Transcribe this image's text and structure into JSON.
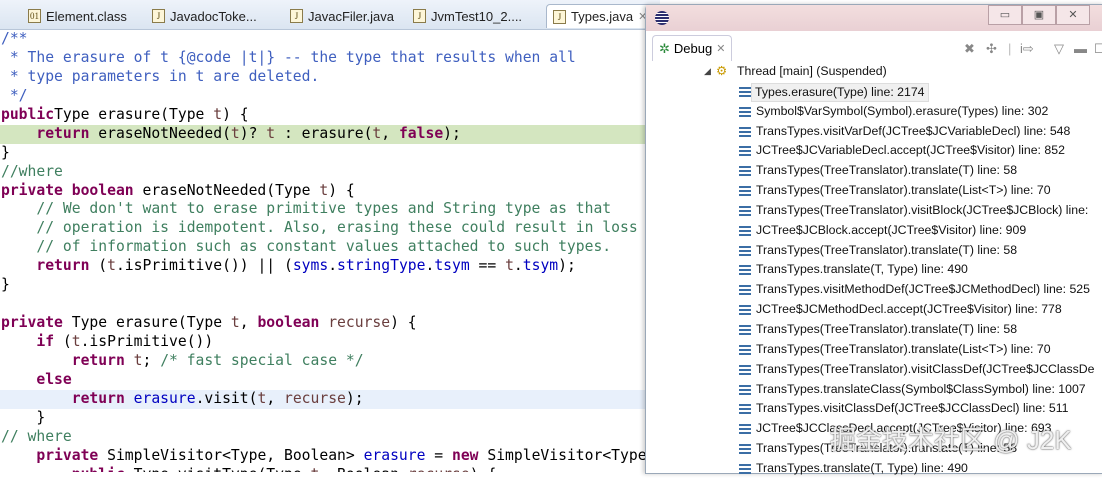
{
  "editor_tabs": [
    {
      "label": "Element.class",
      "icon": "class-file-icon"
    },
    {
      "label": "JavadocToke...",
      "icon": "java-file-icon"
    },
    {
      "label": "JavacFiler.java",
      "icon": "java-file-warning-icon"
    },
    {
      "label": "JvmTest10_2....",
      "icon": "java-file-icon"
    },
    {
      "label": "Types.java",
      "icon": "java-file-warning-icon",
      "active": true
    }
  ],
  "code_lines": [
    {
      "t": [
        [
          "jd",
          "/**"
        ]
      ]
    },
    {
      "t": [
        [
          "jd",
          " * The erasure of t {@code |t|} -- the type that results when all"
        ]
      ]
    },
    {
      "t": [
        [
          "jd",
          " * type parameters in t are deleted."
        ]
      ]
    },
    {
      "t": [
        [
          "jd",
          " */"
        ]
      ]
    },
    {
      "t": [
        [
          "kw",
          "public"
        ],
        [
          "",
          "Type erasure(Type "
        ],
        [
          "var",
          "t"
        ],
        [
          "",
          ") {"
        ]
      ]
    },
    {
      "hl": "green",
      "t": [
        [
          "",
          "    "
        ],
        [
          "kw",
          "return"
        ],
        [
          "",
          " eraseNotNeeded("
        ],
        [
          "var",
          "t"
        ],
        [
          "",
          ")? "
        ],
        [
          "var",
          "t"
        ],
        [
          "",
          " : erasure("
        ],
        [
          "var",
          "t"
        ],
        [
          "",
          ", "
        ],
        [
          "kw",
          "false"
        ],
        [
          "",
          ");"
        ]
      ]
    },
    {
      "t": [
        [
          "",
          "}"
        ]
      ]
    },
    {
      "t": [
        [
          "cm",
          "//where"
        ]
      ]
    },
    {
      "t": [
        [
          "kw",
          "private boolean"
        ],
        [
          "",
          " eraseNotNeeded(Type "
        ],
        [
          "var",
          "t"
        ],
        [
          "",
          ") {"
        ]
      ]
    },
    {
      "t": [
        [
          "",
          "    "
        ],
        [
          "cm",
          "// We don't want to erase primitive types and String type as that"
        ]
      ]
    },
    {
      "t": [
        [
          "",
          "    "
        ],
        [
          "cm",
          "// operation is idempotent. Also, erasing these could result in loss"
        ]
      ]
    },
    {
      "t": [
        [
          "",
          "    "
        ],
        [
          "cm",
          "// of information such as constant values attached to such types."
        ]
      ]
    },
    {
      "t": [
        [
          "",
          "    "
        ],
        [
          "kw",
          "return"
        ],
        [
          "",
          " ("
        ],
        [
          "var",
          "t"
        ],
        [
          "",
          ".isPrimitive()) || ("
        ],
        [
          "fld",
          "syms"
        ],
        [
          "",
          "."
        ],
        [
          "fld",
          "stringType"
        ],
        [
          "",
          "."
        ],
        [
          "fld",
          "tsym"
        ],
        [
          "",
          " == "
        ],
        [
          "var",
          "t"
        ],
        [
          "",
          "."
        ],
        [
          "fld",
          "tsym"
        ],
        [
          "",
          ");"
        ]
      ]
    },
    {
      "t": [
        [
          "",
          "}"
        ]
      ]
    },
    {
      "t": [
        [
          "",
          ""
        ]
      ]
    },
    {
      "t": [
        [
          "kw",
          "private"
        ],
        [
          "",
          " Type erasure(Type "
        ],
        [
          "var",
          "t"
        ],
        [
          "",
          ", "
        ],
        [
          "kw",
          "boolean"
        ],
        [
          "var",
          " recurse"
        ],
        [
          "",
          ") {"
        ]
      ]
    },
    {
      "t": [
        [
          "",
          "    "
        ],
        [
          "kw",
          "if"
        ],
        [
          "",
          " ("
        ],
        [
          "var",
          "t"
        ],
        [
          "",
          ".isPrimitive())"
        ]
      ]
    },
    {
      "t": [
        [
          "",
          "        "
        ],
        [
          "kw",
          "return"
        ],
        [
          "var",
          " t"
        ],
        [
          "",
          "; "
        ],
        [
          "cm",
          "/* fast special case */"
        ]
      ]
    },
    {
      "t": [
        [
          "",
          "    "
        ],
        [
          "kw",
          "else"
        ]
      ]
    },
    {
      "hl": "blue",
      "t": [
        [
          "",
          "        "
        ],
        [
          "kw",
          "return"
        ],
        [
          "fld",
          " erasure"
        ],
        [
          "",
          ".visit("
        ],
        [
          "var",
          "t"
        ],
        [
          "",
          ", "
        ],
        [
          "var",
          "recurse"
        ],
        [
          "",
          ");"
        ]
      ]
    },
    {
      "t": [
        [
          "",
          "    }"
        ]
      ]
    },
    {
      "t": [
        [
          "cm",
          "// where"
        ]
      ]
    },
    {
      "t": [
        [
          "",
          "    "
        ],
        [
          "kw",
          "private"
        ],
        [
          "",
          " SimpleVisitor<Type, Boolean> "
        ],
        [
          "fld",
          "erasure"
        ],
        [
          "",
          " = "
        ],
        [
          "kw",
          "new"
        ],
        [
          "",
          " SimpleVisitor<Type, Boolean>() {"
        ]
      ]
    },
    {
      "t": [
        [
          "",
          "        "
        ],
        [
          "kw",
          "public"
        ],
        [
          "",
          " Type visitType(Type "
        ],
        [
          "var",
          "t"
        ],
        [
          "",
          ", Boolean "
        ],
        [
          "var",
          "recurse"
        ],
        [
          "",
          ") {"
        ]
      ]
    }
  ],
  "debug": {
    "tab_label": "Debug",
    "thread_label": "Thread [main] (Suspended)",
    "frames": [
      "Types.erasure(Type) line: 2174",
      "Symbol$VarSymbol(Symbol).erasure(Types) line: 302",
      "TransTypes.visitVarDef(JCTree$JCVariableDecl) line: 548",
      "JCTree$JCVariableDecl.accept(JCTree$Visitor) line: 852",
      "TransTypes(TreeTranslator).translate(T) line: 58",
      "TransTypes(TreeTranslator).translate(List<T>) line: 70",
      "TransTypes(TreeTranslator).visitBlock(JCTree$JCBlock) line:",
      "JCTree$JCBlock.accept(JCTree$Visitor) line: 909",
      "TransTypes(TreeTranslator).translate(T) line: 58",
      "TransTypes.translate(T, Type) line: 490",
      "TransTypes.visitMethodDef(JCTree$JCMethodDecl) line: 525",
      "JCTree$JCMethodDecl.accept(JCTree$Visitor) line: 778",
      "TransTypes(TreeTranslator).translate(T) line: 58",
      "TransTypes(TreeTranslator).translate(List<T>) line: 70",
      "TransTypes(TreeTranslator).visitClassDef(JCTree$JCClassDe",
      "TransTypes.translateClass(Symbol$ClassSymbol) line: 1007",
      "TransTypes.visitClassDef(JCTree$JCClassDecl) line: 511",
      "JCTree$JCClassDecl.accept(JCTree$Visitor) line: 693",
      "TransTypes(TreeTranslator).translate(T) line: 58",
      "TransTypes.translate(T, Type) line: 490"
    ]
  },
  "watermark": "掘金技术社区 @ J2K"
}
